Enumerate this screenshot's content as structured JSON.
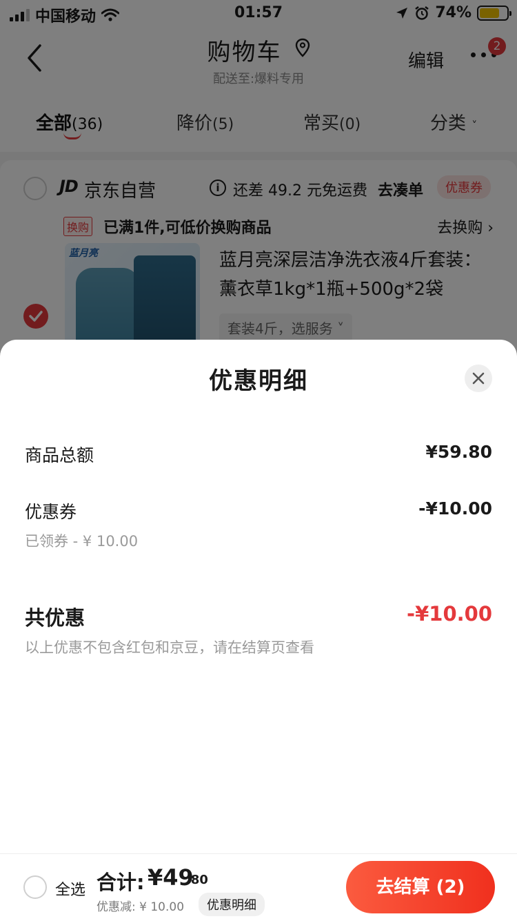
{
  "status_bar": {
    "carrier": "中国移动",
    "time": "01:57",
    "battery": "74%"
  },
  "header": {
    "title": "购物车",
    "subtitle": "配送至:爆料专用",
    "edit_label": "编辑",
    "notification_count": "2"
  },
  "tabs": [
    {
      "label": "全部",
      "count": "(36)"
    },
    {
      "label": "降价",
      "count": "(5)"
    },
    {
      "label": "常买",
      "count": "(0)"
    },
    {
      "label": "分类",
      "count": ""
    }
  ],
  "store": {
    "logo": "JD",
    "name": "京东自营",
    "shipping_note": "还差 49.2 元免运费",
    "shipping_action": "去凑单",
    "coupon_tag": "优惠券",
    "promo_tag": "换购",
    "promo_text": "已满1件,可低价换购商品",
    "promo_action": "去换购 ›"
  },
  "product": {
    "brand_mark": "蓝月亮",
    "title": "蓝月亮深层洁净洗衣液4斤套装：薰衣草1kg*1瓶+500g*2袋",
    "spec": "套装4斤，选服务 ˅"
  },
  "sheet": {
    "title": "优惠明细",
    "goods_total_label": "商品总额",
    "goods_total_value": "¥59.80",
    "coupon_label": "优惠券",
    "coupon_value": "-¥10.00",
    "coupon_sub": "已领券 - ¥ 10.00",
    "total_discount_label": "共优惠",
    "total_discount_value": "-¥10.00",
    "note": "以上优惠不包含红包和京豆，请在结算页查看"
  },
  "bottom_bar": {
    "select_all_label": "全选",
    "sum_label": "合计:",
    "sum_integer": "¥49",
    "sum_decimal": ".80",
    "discount_line": "优惠减: ¥ 10.00",
    "detail_chip": "优惠明细",
    "checkout_label": "去结算 (2)"
  },
  "colors": {
    "accent": "#e4393c",
    "checkout_gradient_start": "#fb5b3f",
    "checkout_gradient_end": "#f0301e"
  }
}
